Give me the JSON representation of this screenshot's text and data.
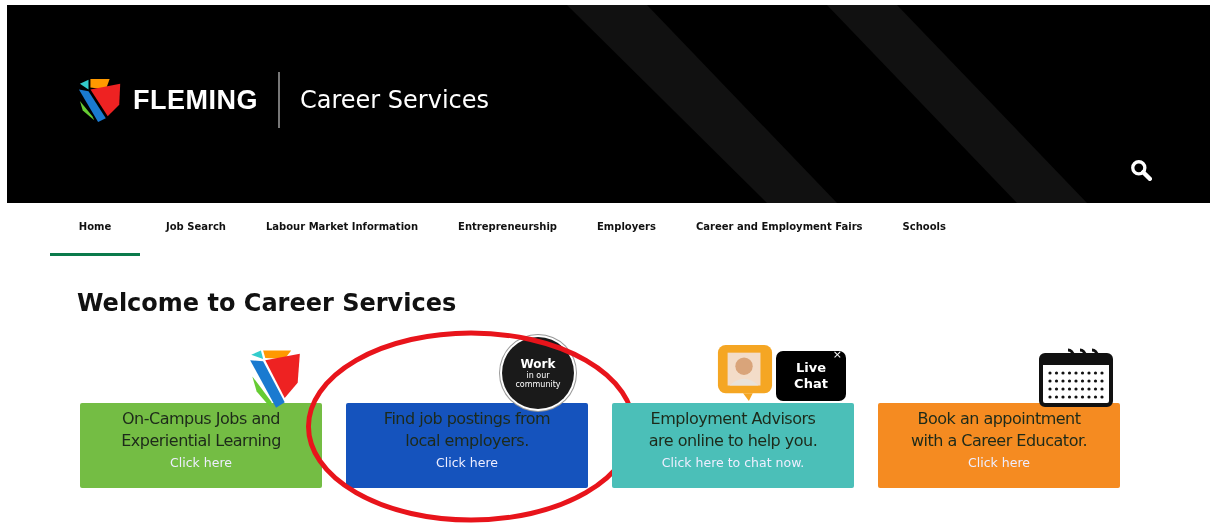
{
  "header": {
    "brand": "FLEMING",
    "site_title": "Career Services"
  },
  "nav": [
    {
      "label": "Home",
      "selected": true
    },
    {
      "label": "Job Search",
      "selected": false
    },
    {
      "label": "Labour Market Information",
      "selected": false
    },
    {
      "label": "Entrepreneurship",
      "selected": false
    },
    {
      "label": "Employers",
      "selected": false
    },
    {
      "label": "Career and Employment Fairs",
      "selected": false
    },
    {
      "label": "Schools",
      "selected": false
    }
  ],
  "heading": "Welcome to Career Services",
  "cards": [
    {
      "kind": "shield",
      "color": "#74bd44",
      "lines": [
        "On-Campus Jobs and",
        "Experiential Learning"
      ],
      "link": "Click here"
    },
    {
      "kind": "badge",
      "color": "#1553bd",
      "lines": [
        "Find job postings from",
        "local employers."
      ],
      "link": "Click here",
      "badge": [
        "Work",
        "in our",
        "community"
      ],
      "circled": true
    },
    {
      "kind": "chat",
      "color": "#4bbfb8",
      "lines": [
        "Employment Advisors",
        "are online to help you."
      ],
      "link": "Click here to chat now.",
      "chat": {
        "label": "Live Chat",
        "close": "×"
      }
    },
    {
      "kind": "calendar",
      "color": "#f58b21",
      "lines": [
        "Book an appointment",
        "with a Career Educator."
      ],
      "link": "Click here"
    }
  ]
}
